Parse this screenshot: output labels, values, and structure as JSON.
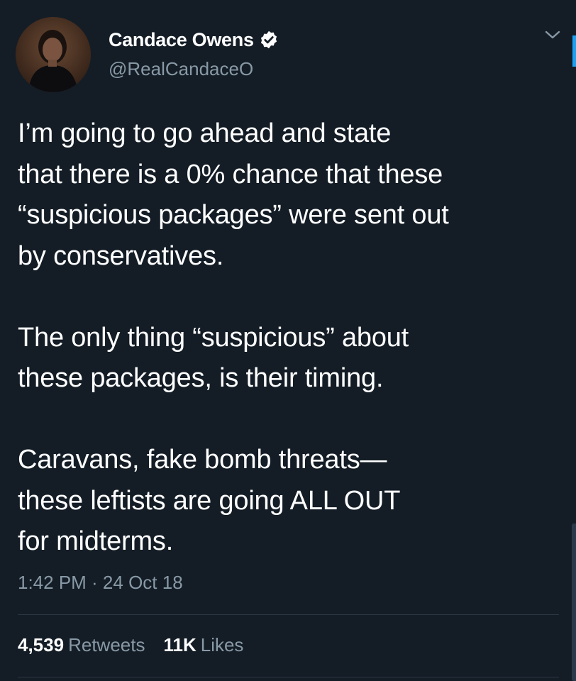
{
  "tweet": {
    "author": {
      "display_name": "Candace Owens",
      "handle": "@RealCandaceO",
      "verified": true
    },
    "paragraphs": [
      "I’m going to go ahead and state\nthat there is a 0% chance that these\n“suspicious packages” were sent out\nby conservatives.",
      "The only thing “suspicious” about\nthese packages, is their timing.",
      "Caravans, fake bomb threats—\nthese leftists are going ALL OUT\nfor midterms."
    ],
    "timestamp": "1:42 PM · 24 Oct 18",
    "stats": {
      "retweets_count": "4,539",
      "retweets_label": "Retweets",
      "likes_count": "11K",
      "likes_label": "Likes"
    }
  },
  "icons": {
    "verified": "verified-badge-icon",
    "menu": "chevron-down-icon"
  },
  "colors": {
    "background": "#141d26",
    "text_primary": "#ffffff",
    "text_secondary": "#8899a6",
    "accent": "#1da1f2",
    "divider": "#2c3945"
  }
}
